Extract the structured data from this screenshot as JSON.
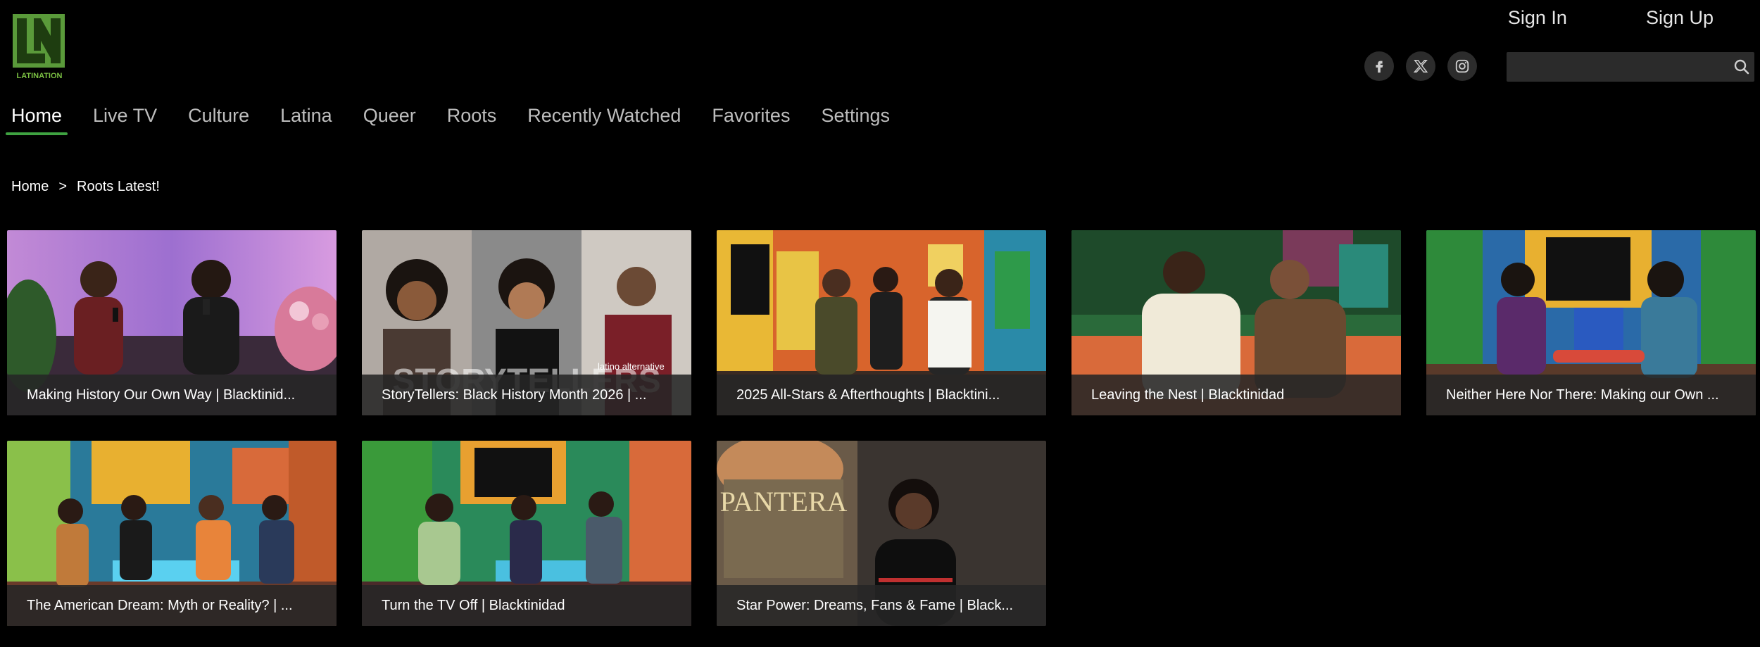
{
  "brand": {
    "logo_text": "LATINATION",
    "logo_mark": "LN",
    "accent": "#3fa341"
  },
  "auth": {
    "sign_in": "Sign In",
    "sign_up": "Sign Up"
  },
  "social": [
    {
      "name": "facebook-icon",
      "glyph": "f"
    },
    {
      "name": "x-twitter-icon",
      "glyph": "𝕏"
    },
    {
      "name": "instagram-icon",
      "glyph": ""
    }
  ],
  "search": {
    "placeholder": "",
    "value": ""
  },
  "nav": [
    {
      "label": "Home",
      "active": true
    },
    {
      "label": "Live TV"
    },
    {
      "label": "Culture"
    },
    {
      "label": "Latina"
    },
    {
      "label": "Queer"
    },
    {
      "label": "Roots"
    },
    {
      "label": "Recently Watched"
    },
    {
      "label": "Favorites"
    },
    {
      "label": "Settings"
    }
  ],
  "breadcrumb": {
    "home": "Home",
    "separator": ">",
    "current": "Roots Latest!"
  },
  "cards": [
    {
      "title": "Making History Our Own Way | Blacktinid...",
      "scene": "studio-pink"
    },
    {
      "title": "StoryTellers: Black History Month 2026 | ...",
      "scene": "portraits",
      "overlay_text": "STORYTELLERS",
      "overlay_sub": "latino alternative"
    },
    {
      "title": "2025 All-Stars & Afterthoughts | Blacktini...",
      "scene": "colorful-set"
    },
    {
      "title": "Leaving the Nest | Blacktinidad",
      "scene": "jungle-set"
    },
    {
      "title": "Neither Here Nor There: Making our Own ...",
      "scene": "game-set"
    },
    {
      "title": "The American Dream: Myth or Reality? | ...",
      "scene": "panel-set"
    },
    {
      "title": "Turn the TV Off | Blacktinidad",
      "scene": "panel-set-2"
    },
    {
      "title": "Star Power: Dreams, Fans & Fame | Black...",
      "scene": "pantera",
      "overlay_text": "PANTERA"
    }
  ]
}
